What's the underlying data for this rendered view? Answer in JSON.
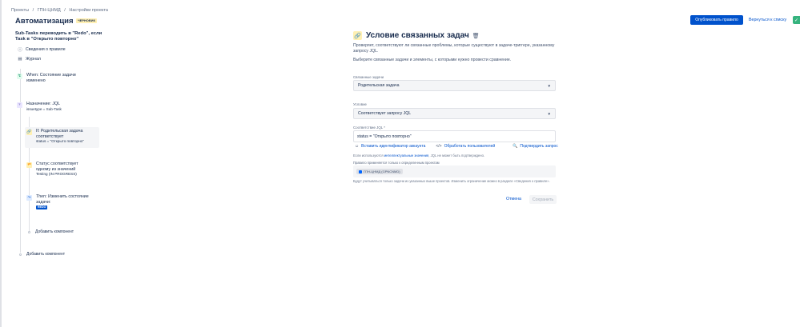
{
  "breadcrumbs": [
    "Проекты",
    "/",
    "ГПН-ЦНМД",
    "/",
    "Настройки проекта"
  ],
  "page_title": "Автоматизация",
  "status_lozenge": "ЧЕРНОВИК",
  "header": {
    "publish_label": "Опубликовать правило",
    "back_label": "Вернуться к списку"
  },
  "rule": {
    "name": "Sub-Tasks переводить в \"Redo\", если Task в \"Открыто повторно\"",
    "details_label": "Сведения о правиле",
    "log_label": "Журнал"
  },
  "steps": {
    "trigger": {
      "line1": "When: Состояние задачи",
      "line2": "изменено"
    },
    "branch": {
      "line1": "Назначение: JQL",
      "line2": "issuetype = Sub-Task"
    },
    "condition_selected": {
      "line1": "If: Родительская задача",
      "line2": "соответствует",
      "line3": "status = \"Открыто повторно\""
    },
    "condition2": {
      "line1": "Статус соответствует",
      "line2": "одному из значений",
      "line3": "Testing (IN PROGRESS)"
    },
    "action": {
      "line1": "Then: Изменить состояние",
      "line2": "задачи:",
      "tag": "REDO"
    },
    "add_component_inner": "Добавить компонент",
    "add_component_outer": "Добавить компонент"
  },
  "panel": {
    "title": "Условие связанных задач",
    "description": "Проверяет, соответствуют ли связанные проблемы, которые существуют в задаче-триггере, указанному запросу JQL.",
    "description2": "Выберите связанные задачи и элементы, с которыми нужно провести сравнение.",
    "related_label": "Связанные задачи",
    "related_value": "Родительская задача",
    "condition_label": "Условие",
    "condition_value": "Соответствует запросу JQL",
    "jql_label": "Соответствие JQL *",
    "jql_value": "status = \"Открыто повторно\"",
    "insert_account": "Вставить идентификатор аккаунта",
    "process_users": "Обработать пользователей",
    "validate_query": "Подтвердить запрос",
    "hint_prefix": "Если используются ",
    "hint_link": "интеллектуальные значения",
    "hint_suffix": ", JQL не может быть подтверждено.",
    "projects_label": "Правило применяется только к определенным проектам",
    "project_chip": "ГПН-ЦНМД (GPNCNMD)",
    "note": "Будут учитываться только задачи из указанных выше проектов. Изменить ограничение можно в разделе «Сведения о правиле».",
    "cancel_label": "Отмена",
    "save_label": "Сохранить"
  }
}
